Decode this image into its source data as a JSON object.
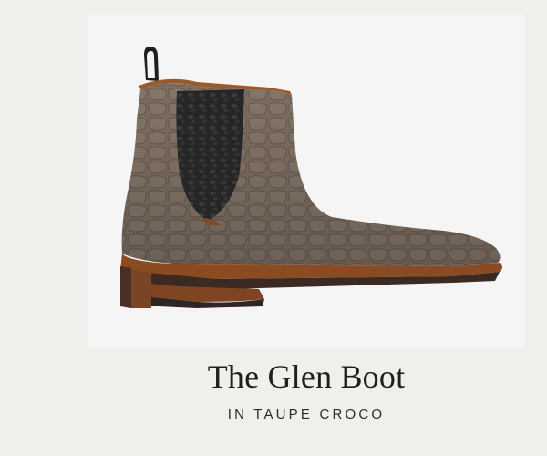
{
  "product": {
    "title": "The Glen Boot",
    "subtitle": "IN TAUPE CROCO",
    "image_alt_name": "chelsea-boot-image"
  },
  "colors": {
    "page_background": "#f0efeb",
    "image_background": "#f5f5f5",
    "suede": "#7d6e61",
    "elastic_gore": "#262626",
    "sole_welt": "#8a4a22",
    "sole_bottom": "#3a2a22",
    "title_text": "#1f1f1f"
  }
}
